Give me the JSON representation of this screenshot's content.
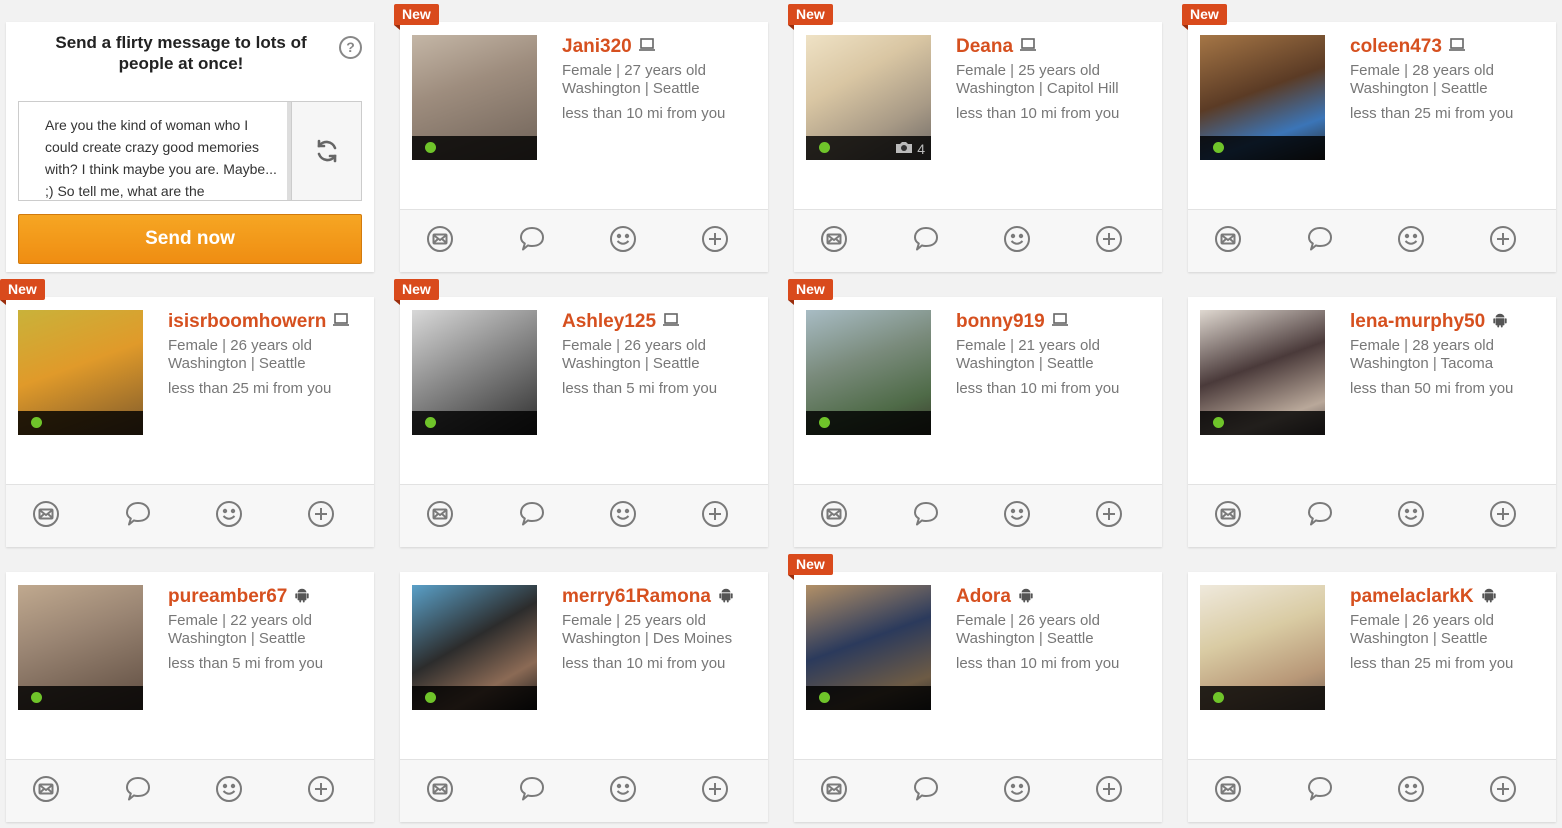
{
  "composer": {
    "title": "Send a flirty message to lots of people at once!",
    "help_glyph": "?",
    "message": "Are you the kind of woman who I could create crazy good memories with? I think maybe you are. Maybe... ;) So tell me, what are the",
    "send_label": "Send now"
  },
  "badge_label": "New",
  "colors": {
    "accent": "#d6501f",
    "badge": "#d94a1c",
    "online": "#6fc42a",
    "button": "#f39c1c"
  },
  "profiles": [
    {
      "name": "Jani320",
      "device": "laptop-icon",
      "new": true,
      "gender_age": "Female  |  27 years old",
      "location": "Washington  |  Seattle",
      "distance": "less than 10 mi from you",
      "photos": ""
    },
    {
      "name": "Deana",
      "device": "laptop-icon",
      "new": true,
      "gender_age": "Female  |  25 years old",
      "location": "Washington  |  Capitol Hill",
      "distance": "less than 10 mi from you",
      "photos": "4"
    },
    {
      "name": "coleen473",
      "device": "laptop-icon",
      "new": true,
      "gender_age": "Female  |  28 years old",
      "location": "Washington  |  Seattle",
      "distance": "less than 25 mi from you",
      "photos": ""
    },
    {
      "name": "isisrboomhowern",
      "device": "laptop-icon",
      "new": true,
      "gender_age": "Female  |  26 years old",
      "location": "Washington  |  Seattle",
      "distance": "less than 25 mi from you",
      "photos": ""
    },
    {
      "name": "Ashley125",
      "device": "laptop-icon",
      "new": true,
      "gender_age": "Female  |  26 years old",
      "location": "Washington  |  Seattle",
      "distance": "less than 5 mi from you",
      "photos": ""
    },
    {
      "name": "bonny919",
      "device": "laptop-icon",
      "new": true,
      "gender_age": "Female  |  21 years old",
      "location": "Washington  |  Seattle",
      "distance": "less than 10 mi from you",
      "photos": ""
    },
    {
      "name": "lena-murphy50",
      "device": "android-icon",
      "new": false,
      "gender_age": "Female  |  28 years old",
      "location": "Washington  |  Tacoma",
      "distance": "less than 50 mi from you",
      "photos": ""
    },
    {
      "name": "pureamber67",
      "device": "android-icon",
      "new": false,
      "gender_age": "Female  |  22 years old",
      "location": "Washington  |  Seattle",
      "distance": "less than 5 mi from you",
      "photos": ""
    },
    {
      "name": "merry61Ramona",
      "device": "android-icon",
      "new": false,
      "gender_age": "Female  |  25 years old",
      "location": "Washington  |  Des Moines",
      "distance": "less than 10 mi from you",
      "photos": ""
    },
    {
      "name": "Adora",
      "device": "android-icon",
      "new": true,
      "gender_age": "Female  |  26 years old",
      "location": "Washington  |  Seattle",
      "distance": "less than 10 mi from you",
      "photos": ""
    },
    {
      "name": "pamelaclarkK",
      "device": "android-icon",
      "new": false,
      "gender_age": "Female  |  26 years old",
      "location": "Washington  |  Seattle",
      "distance": "less than 25 mi from you",
      "photos": ""
    }
  ],
  "actions": [
    "mail-icon",
    "chat-icon",
    "smile-icon",
    "add-icon"
  ]
}
